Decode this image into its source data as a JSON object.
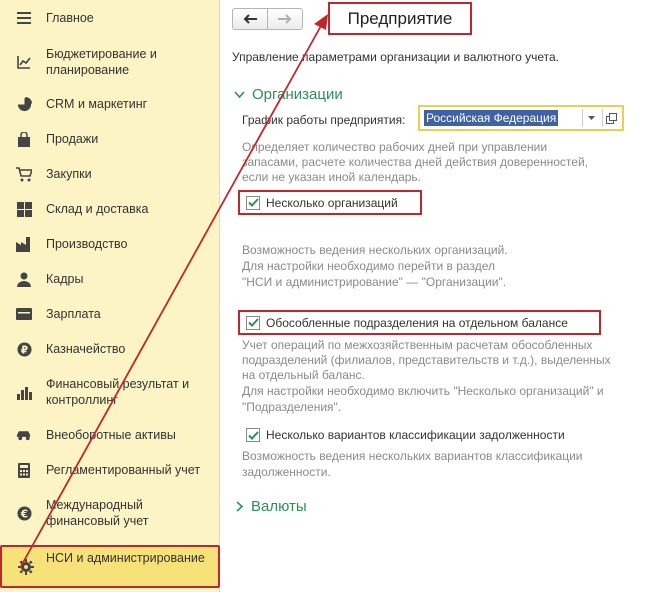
{
  "sidebar": {
    "items": [
      {
        "label": "Главное",
        "icon": "menu-lines-icon"
      },
      {
        "label": "Бюджетирование и планирование",
        "icon": "budget-icon"
      },
      {
        "label": "CRM и маркетинг",
        "icon": "pie-chart-icon"
      },
      {
        "label": "Продажи",
        "icon": "shopping-bag-icon"
      },
      {
        "label": "Закупки",
        "icon": "cart-icon"
      },
      {
        "label": "Склад и доставка",
        "icon": "warehouse-grid-icon"
      },
      {
        "label": "Производство",
        "icon": "factory-icon"
      },
      {
        "label": "Кадры",
        "icon": "person-icon"
      },
      {
        "label": "Зарплата",
        "icon": "wallet-icon"
      },
      {
        "label": "Казначейство",
        "icon": "coin-icon"
      },
      {
        "label": "Финансовый результат и контроллинг",
        "icon": "bar-chart-icon"
      },
      {
        "label": "Внеоборотные активы",
        "icon": "car-icon"
      },
      {
        "label": "Регламентированный учет",
        "icon": "calculator-icon"
      },
      {
        "label": "Международный финансовый учет",
        "icon": "euro-icon"
      },
      {
        "label": "НСИ и администрирование",
        "icon": "gear-icon"
      }
    ],
    "selected_index": 14
  },
  "header": {
    "title": "Предприятие",
    "description": "Управление параметрами организации и валютного учета."
  },
  "organizations": {
    "section_title": "Организации",
    "schedule_label": "График работы предприятия:",
    "schedule_value": "Российская Федерация",
    "schedule_hint_1": "Определяет количество рабочих дней при управлении",
    "schedule_hint_2": "запасами, расчете количества дней действия доверенностей,",
    "schedule_hint_3": "если не указан иной календарь.",
    "multi_org_label": "Несколько организаций",
    "multi_org_checked": true,
    "multi_org_hint_1": "Возможность ведения нескольких организаций.",
    "multi_org_hint_2": "Для настройки необходимо перейти в раздел",
    "multi_org_hint_3": "\"НСИ и администрирование\" — \"Организации\".",
    "separate_div_label": "Обособленные подразделения на отдельном балансе",
    "separate_div_checked": true,
    "separate_div_hint_1": "Учет операций по межхозяйственным расчетам обособленных",
    "separate_div_hint_2": "подразделений (филиалов, представительств и т.д.), выделенных",
    "separate_div_hint_3": "на отдельный баланс.",
    "separate_div_hint_4": "Для настройки необходимо включить \"Несколько организаций\" и",
    "separate_div_hint_5": "\"Подразделения\".",
    "debt_class_label": "Несколько вариантов классификации задолженности",
    "debt_class_checked": true,
    "debt_class_hint_1": "Возможность ведения нескольких вариантов классификации",
    "debt_class_hint_2": "задолженности."
  },
  "currencies": {
    "section_title": "Валюты"
  },
  "colors": {
    "sidebar_bg": "#fcf4c5",
    "selected_bg": "#f7e27a",
    "highlight_red": "#c0272d",
    "section_green": "#2d8f5a",
    "combo_border": "#e8cf55",
    "selection_blue": "#3e62a3"
  }
}
